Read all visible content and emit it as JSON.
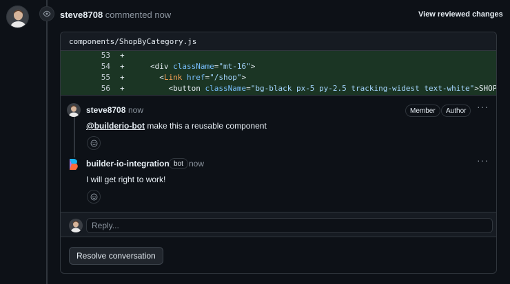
{
  "timeline": {
    "author": "steve8708",
    "action": "commented",
    "time": "now",
    "view_reviewed": "View reviewed changes"
  },
  "file": {
    "path": "components/ShopByCategory.js",
    "lines": [
      {
        "num": "53",
        "sign": "+",
        "parts": []
      },
      {
        "num": "54",
        "sign": "+",
        "parts": [
          [
            "tag",
            "<div "
          ],
          [
            "attr",
            "className"
          ],
          [
            "tag",
            "="
          ],
          [
            "str",
            "\"mt-16\""
          ],
          [
            "tag",
            ">"
          ]
        ]
      },
      {
        "num": "55",
        "sign": "+",
        "parts": [
          [
            "tag",
            "  <"
          ],
          [
            "comp",
            "Link"
          ],
          [
            "attr",
            " href"
          ],
          [
            "tag",
            "="
          ],
          [
            "str",
            "\"/shop\""
          ],
          [
            "tag",
            ">"
          ]
        ]
      },
      {
        "num": "56",
        "sign": "+",
        "parts": [
          [
            "tag",
            "    <button "
          ],
          [
            "attr",
            "className"
          ],
          [
            "tag",
            "="
          ],
          [
            "str",
            "\"bg-black px-5 py-2.5 tracking-widest text-white\""
          ],
          [
            "tag",
            ">SHOP ALL</button>"
          ]
        ]
      }
    ]
  },
  "comments": [
    {
      "author": "steve8708",
      "time": "now",
      "badges": [
        "Member",
        "Author"
      ],
      "mention": "@builderio-bot",
      "body": " make this a reusable component"
    },
    {
      "author": "builder-io-integration",
      "bot_badge": "bot",
      "time": "now",
      "body": "I will get right to work!"
    }
  ],
  "reply": {
    "placeholder": "Reply..."
  },
  "resolve_label": "Resolve conversation",
  "colors": {
    "bg": "#0d1117",
    "diff_added": "#1b3524",
    "border": "#30363d"
  }
}
